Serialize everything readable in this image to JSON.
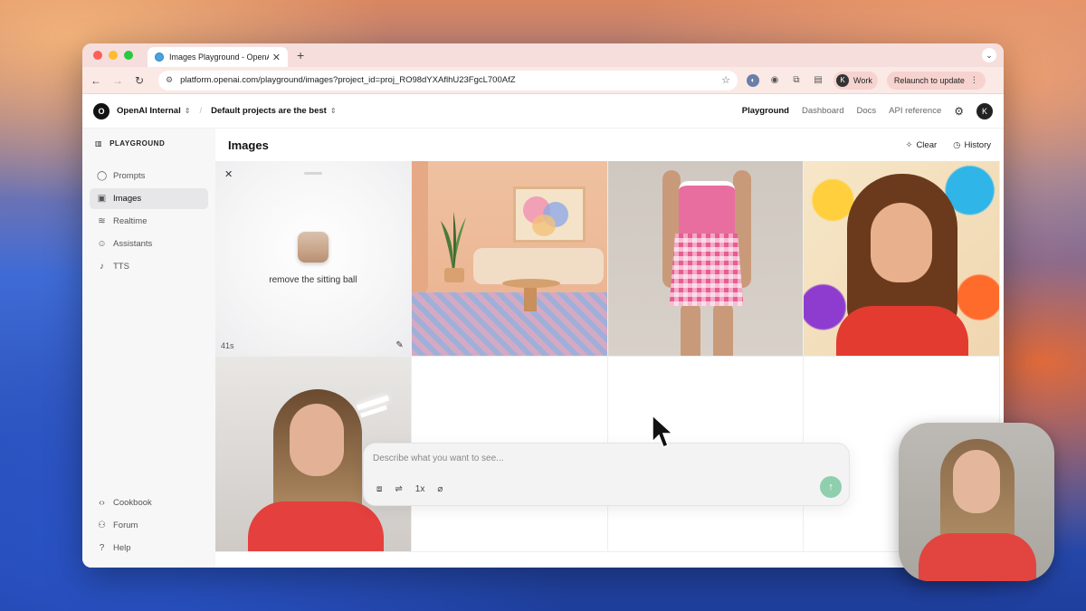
{
  "browser": {
    "tab_title": "Images Playground - OpenAI",
    "url": "platform.openai.com/playground/images?project_id=proj_RO98dYXAflhU23FgcL700AfZ",
    "profile_initial": "K",
    "profile_label": "Work",
    "relaunch_label": "Relaunch to update"
  },
  "header": {
    "org_initial": "O",
    "org_name": "OpenAI Internal",
    "project_name": "Default projects are the best",
    "nav": [
      "Playground",
      "Dashboard",
      "Docs",
      "API reference"
    ],
    "user_initial": "K"
  },
  "sidebar": {
    "title": "PLAYGROUND",
    "items": [
      {
        "label": "Prompts",
        "icon": "chat-icon"
      },
      {
        "label": "Images",
        "icon": "image-icon"
      },
      {
        "label": "Realtime",
        "icon": "waveform-icon"
      },
      {
        "label": "Assistants",
        "icon": "assistant-icon"
      },
      {
        "label": "TTS",
        "icon": "microphone-icon"
      }
    ],
    "bottom_items": [
      {
        "label": "Cookbook",
        "icon": "code-icon"
      },
      {
        "label": "Forum",
        "icon": "people-icon"
      },
      {
        "label": "Help",
        "icon": "help-icon"
      }
    ]
  },
  "main": {
    "title": "Images",
    "clear_label": "Clear",
    "history_label": "History",
    "pending": {
      "prompt": "remove the sitting ball",
      "elapsed": "41s"
    },
    "composer": {
      "placeholder": "Describe what you want to see...",
      "count_label": "1x"
    }
  }
}
